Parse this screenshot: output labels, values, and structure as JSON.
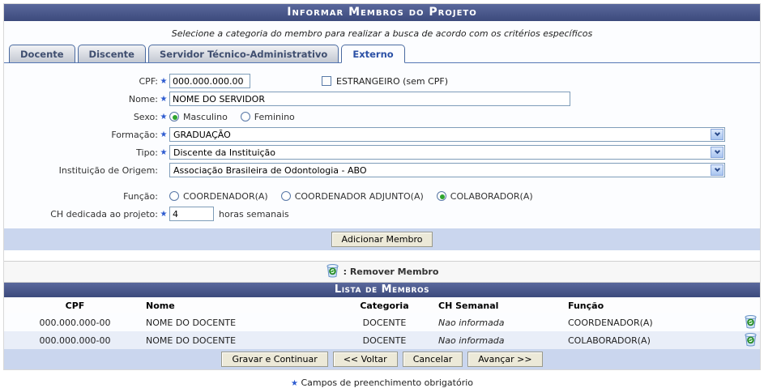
{
  "header": {
    "title": "Informar Membros do Projeto"
  },
  "instruction": "Selecione a categoria do membro para realizar a busca de acordo com os critérios específicos",
  "tabs": [
    {
      "label": "Docente",
      "active": false
    },
    {
      "label": "Discente",
      "active": false
    },
    {
      "label": "Servidor Técnico-Administrativo",
      "active": false
    },
    {
      "label": "Externo",
      "active": true
    }
  ],
  "form": {
    "cpf": {
      "label": "CPF:",
      "required": true,
      "value": "000.000.000.00"
    },
    "estrangeiro": {
      "label": "ESTRANGEIRO (sem CPF)",
      "checked": false
    },
    "nome": {
      "label": "Nome:",
      "required": true,
      "value": "NOME DO SERVIDOR"
    },
    "sexo": {
      "label": "Sexo:",
      "required": true,
      "options": [
        "Masculino",
        "Feminino"
      ],
      "selected": 0
    },
    "formacao": {
      "label": "Formação:",
      "required": true,
      "value": "GRADUAÇÃO"
    },
    "tipo": {
      "label": "Tipo:",
      "required": true,
      "value": "Discente da Instituição"
    },
    "instituicao": {
      "label": "Instituição de Origem:",
      "required": false,
      "value": "Associação Brasileira de Odontologia - ABO"
    },
    "funcao": {
      "label": "Função:",
      "options": [
        "COORDENADOR(A)",
        "COORDENADOR ADJUNTO(A)",
        "COLABORADOR(A)"
      ],
      "selected": 2
    },
    "ch": {
      "label": "CH dedicada ao projeto:",
      "required": true,
      "value": "4",
      "suffix": "horas semanais"
    },
    "add_button": "Adicionar Membro"
  },
  "legend": {
    "icon": "trash-icon",
    "text": ": Remover Membro"
  },
  "members": {
    "title": "Lista de Membros",
    "columns": [
      "CPF",
      "Nome",
      "Categoria",
      "CH Semanal",
      "Função"
    ],
    "rows": [
      {
        "cpf": "000.000.000-00",
        "nome": "NOME DO DOCENTE",
        "categoria": "DOCENTE",
        "ch": "Nao informada",
        "funcao": "COORDENADOR(A)"
      },
      {
        "cpf": "000.000.000-00",
        "nome": "NOME DO DOCENTE",
        "categoria": "DOCENTE",
        "ch": "Nao informada",
        "funcao": "COLABORADOR(A)"
      }
    ]
  },
  "footer": {
    "buttons": [
      "Gravar e Continuar",
      "<< Voltar",
      "Cancelar",
      "Avançar >>"
    ]
  },
  "required_note": "Campos de preenchimento obrigatório",
  "colors": {
    "header_bar": "#47548c",
    "accent_blue": "#2b50a5",
    "light_blue_bar": "#cad6ee",
    "row_alt": "#e9eef8",
    "required_star": "#2d5bd0"
  }
}
